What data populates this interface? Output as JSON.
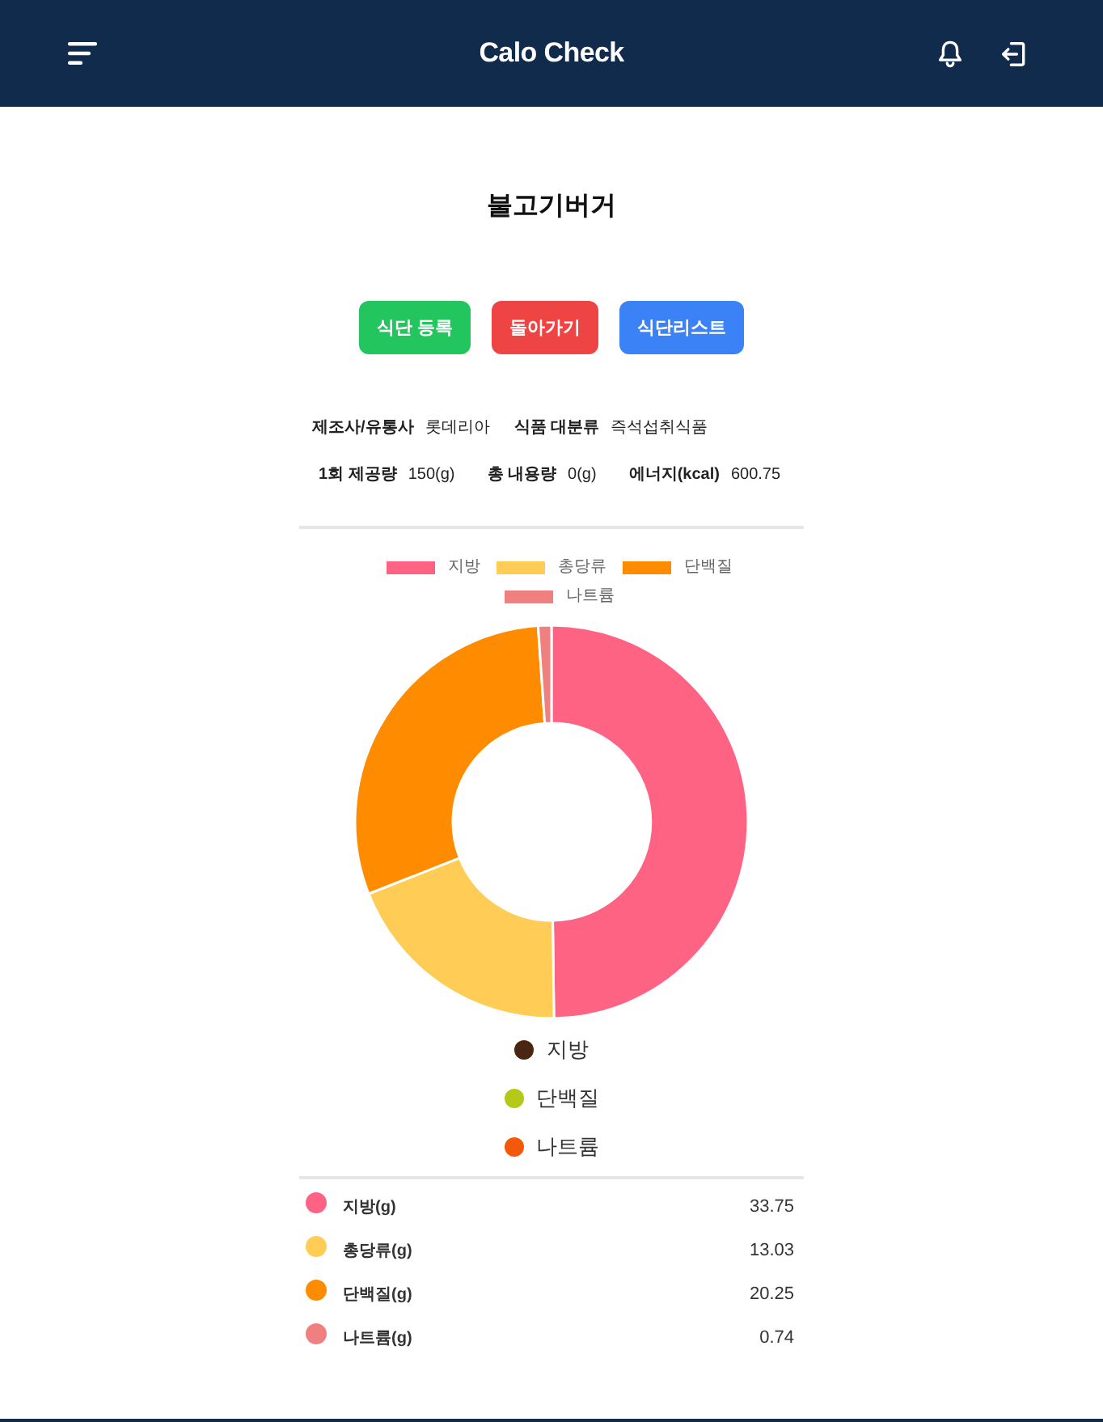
{
  "header": {
    "title": "Calo Check"
  },
  "food": {
    "name": "불고기버거"
  },
  "buttons": [
    {
      "label": "식단 등록",
      "kind": "register"
    },
    {
      "label": "돌아가기",
      "kind": "back"
    },
    {
      "label": "식단리스트",
      "kind": "list"
    }
  ],
  "info": [
    [
      {
        "label": "제조사/유통사",
        "value": "롯데리아"
      },
      {
        "label": "식품 대분류",
        "value": "즉석섭취식품"
      }
    ],
    [
      {
        "label": "1회 제공량",
        "value": "150(g)"
      },
      {
        "label": "총 내용량",
        "value": "0(g)"
      },
      {
        "label": "에너지(kcal)",
        "value": "600.75"
      }
    ]
  ],
  "chart": {
    "legend": [
      {
        "color": "#ff6384"
      },
      {
        "color": "#ffcd56"
      },
      {
        "color": "#ff8c00"
      },
      {
        "color": "#f08080"
      }
    ],
    "chart_data": {
      "type": "donut",
      "categories": [
        "지방",
        "총당류",
        "단백질",
        "나트륨"
      ],
      "values": [
        49.8,
        19.23,
        29.88,
        1.09
      ]
    },
    "dot_legend": [
      {
        "label": "지방",
        "color": "#4a2511"
      },
      {
        "label": "단백질",
        "color": "#b5c919"
      },
      {
        "label": "나트륨",
        "color": "#f4590a"
      }
    ]
  },
  "nutrients": [
    {
      "label": "지방(g)",
      "value": "33.75",
      "color": "#ff6384"
    },
    {
      "label": "총당류(g)",
      "value": "13.03",
      "color": "#ffcd56"
    },
    {
      "label": "단백질(g)",
      "value": "20.25",
      "color": "#ff8c00"
    },
    {
      "label": "나트륨(g)",
      "value": "0.74",
      "color": "#f08080"
    }
  ]
}
